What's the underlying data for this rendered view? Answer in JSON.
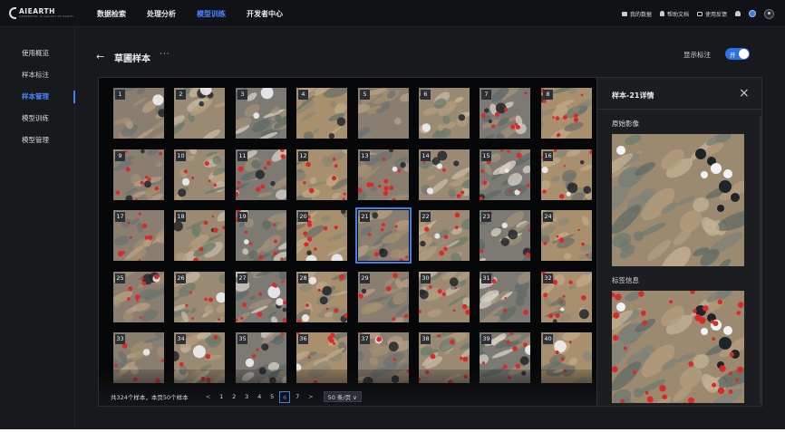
{
  "brand": {
    "name": "AIEARTH",
    "tagline": "GEOSPATIAL AI GALAXY OF EARTH"
  },
  "topnav": {
    "items": [
      "数据检索",
      "处理分析",
      "模型训练",
      "开发者中心"
    ],
    "active": 2
  },
  "topright": {
    "my_data": "我的数据",
    "help_docs": "帮助文档",
    "feedback": "使用反馈"
  },
  "sidebar": {
    "items": [
      "使用概览",
      "样本标注",
      "样本管理",
      "模型训练",
      "模型管理"
    ],
    "active": 2
  },
  "header": {
    "back_icon": "←",
    "title": "草圃样本",
    "more_icon": "···",
    "show_labels": "显示标注",
    "toggle_text": "开",
    "toggle_on": true
  },
  "grid": {
    "tiles": [
      "1",
      "2",
      "3",
      "4",
      "5",
      "6",
      "7",
      "8",
      "9",
      "10",
      "11",
      "12",
      "13",
      "14",
      "15",
      "16",
      "17",
      "18",
      "19",
      "20",
      "21",
      "22",
      "23",
      "24",
      "25",
      "26",
      "27",
      "28",
      "29",
      "30",
      "31",
      "32",
      "33",
      "34",
      "35",
      "36",
      "37",
      "38",
      "39",
      "40"
    ],
    "selected": "21"
  },
  "pagination": {
    "summary": "共324个样本，本页50个样本",
    "prev": "<",
    "pages": [
      "1",
      "2",
      "3",
      "4",
      "5",
      "6",
      "7"
    ],
    "current": "6",
    "next": ">",
    "page_size": "50 条/页 ∨"
  },
  "detail": {
    "title": "样本-21详情",
    "close_icon": "×",
    "original_image": "原始影像",
    "label_info": "标签信息"
  },
  "colors": {
    "accent": "#3f7fe8",
    "bg": "#17191d",
    "label_red": "#d92a2a"
  }
}
